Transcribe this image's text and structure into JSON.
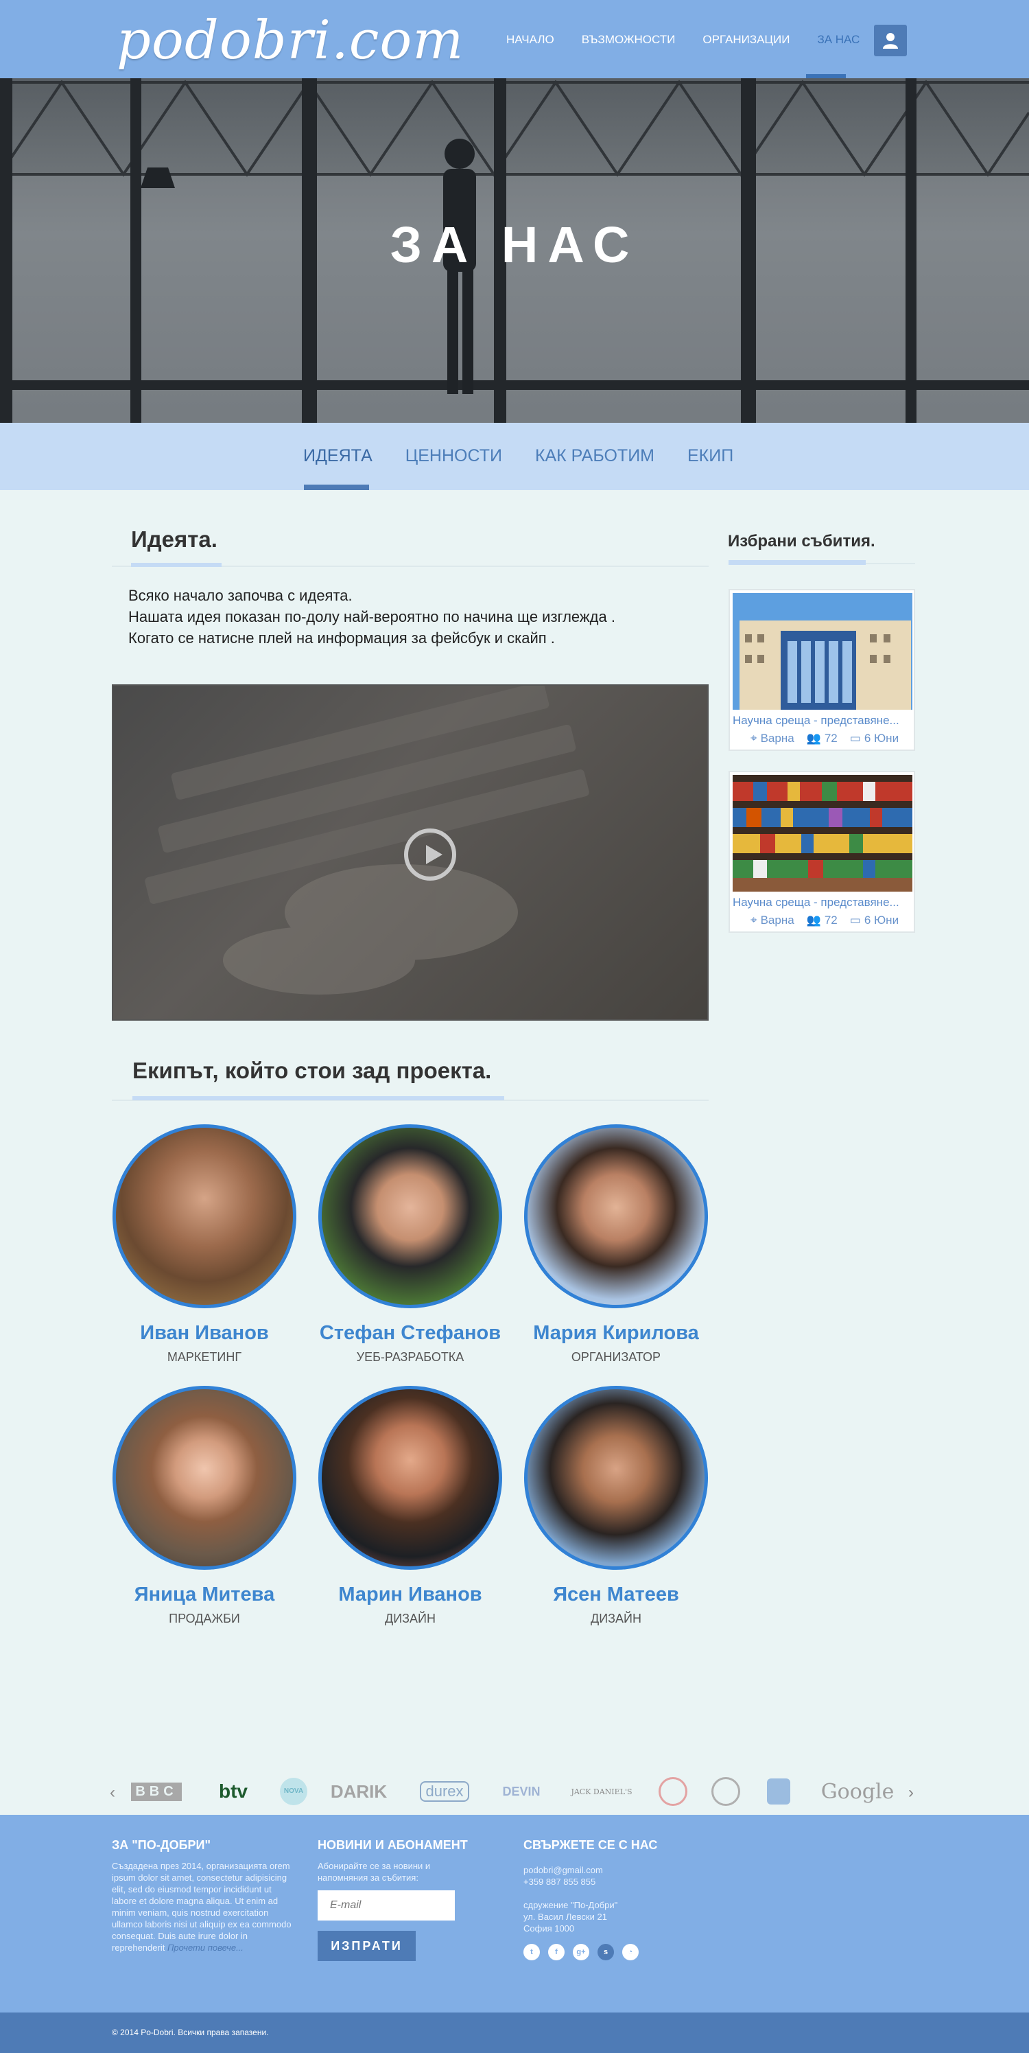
{
  "header": {
    "logo": "podobri.com",
    "nav": [
      {
        "label": "НАЧАЛО"
      },
      {
        "label": "ВЪЗМОЖНОСТИ"
      },
      {
        "label": "ОРГАНИЗАЦИИ"
      },
      {
        "label": "ЗА НАС",
        "active": true
      }
    ],
    "user_icon": "user-icon"
  },
  "hero": {
    "title": "ЗА НАС"
  },
  "subnav": [
    {
      "label": "ИДЕЯТА",
      "active": true
    },
    {
      "label": "ЦЕННОСТИ"
    },
    {
      "label": "КАК РАБОТИМ"
    },
    {
      "label": "ЕКИП"
    }
  ],
  "idea": {
    "title": "Идеята.",
    "lines": [
      "Всяко начало започва с идеята.",
      "Нашата идея показан по-долу най-вероятно по начина ще изглежда .",
      "Когато се натисне плей на информация за фейсбук и скайп ."
    ],
    "video_icon": "play-icon"
  },
  "team": {
    "title": "Екипът, който стои зад проекта.",
    "members": [
      {
        "name": "Иван Иванов",
        "role": "МАРКЕТИНГ"
      },
      {
        "name": "Стефан Стефанов",
        "role": "УЕБ-РАЗРАБОТКА"
      },
      {
        "name": "Мария Кирилова",
        "role": "ОРГАНИЗАТОР"
      },
      {
        "name": "Яница Митева",
        "role": "ПРОДАЖБИ"
      },
      {
        "name": "Марин Иванов",
        "role": "ДИЗАЙН"
      },
      {
        "name": "Ясен Матеев",
        "role": "ДИЗАЙН"
      }
    ]
  },
  "sidebar": {
    "title": "Избрани събития.",
    "events": [
      {
        "title": "Научна среща - представяне...",
        "city": "Варна",
        "people": "72",
        "date": "6 Юни"
      },
      {
        "title": "Научна среща - представяне...",
        "city": "Варна",
        "people": "72",
        "date": "6 Юни"
      }
    ]
  },
  "partners": {
    "prev": "‹",
    "next": "›",
    "logos": [
      "BBC",
      "btv",
      "NOVA",
      "DARIK",
      "durex",
      "DEVIN",
      "JACK DANIEL'S",
      "",
      "",
      "",
      "Google"
    ]
  },
  "footer": {
    "about": {
      "title": "ЗА \"ПО-ДОБРИ\"",
      "text": "Създадена през 2014, организацията orem ipsum dolor sit amet, consectetur adipisicing elit, sed do eiusmod tempor incididunt ut labore et dolore magna aliqua. Ut enim ad minim veniam, quis nostrud exercitation ullamco laboris nisi ut aliquip ex ea commodo consequat. Duis aute irure dolor in reprehenderit",
      "more": "Прочети повече..."
    },
    "news": {
      "title": "НОВИНИ И АБОНАМЕНТ",
      "text": "Абонирайте се за новини и напомняния за събития:",
      "placeholder": "E-mail",
      "button": "ИЗПРАТИ"
    },
    "contact": {
      "title": "СВЪРЖЕТЕ СЕ С НАС",
      "email": "podobri@gmail.com",
      "phone": "+359 887 855 855",
      "org": "сдружение \"По-Добри\"",
      "street": "ул. Васил Левски 21",
      "city": "София 1000",
      "social": [
        "twitter-icon",
        "facebook-icon",
        "google-plus-icon",
        "skype-icon",
        "rss-icon"
      ]
    },
    "copyright": "© 2014 Po-Dobri. Всички права запазени."
  },
  "colors": {
    "header": "#81aee5",
    "accent": "#3e86cf",
    "dark_blue": "#4e7bb6",
    "subnav": "#c5dbf5",
    "background": "#eaf4f4"
  }
}
